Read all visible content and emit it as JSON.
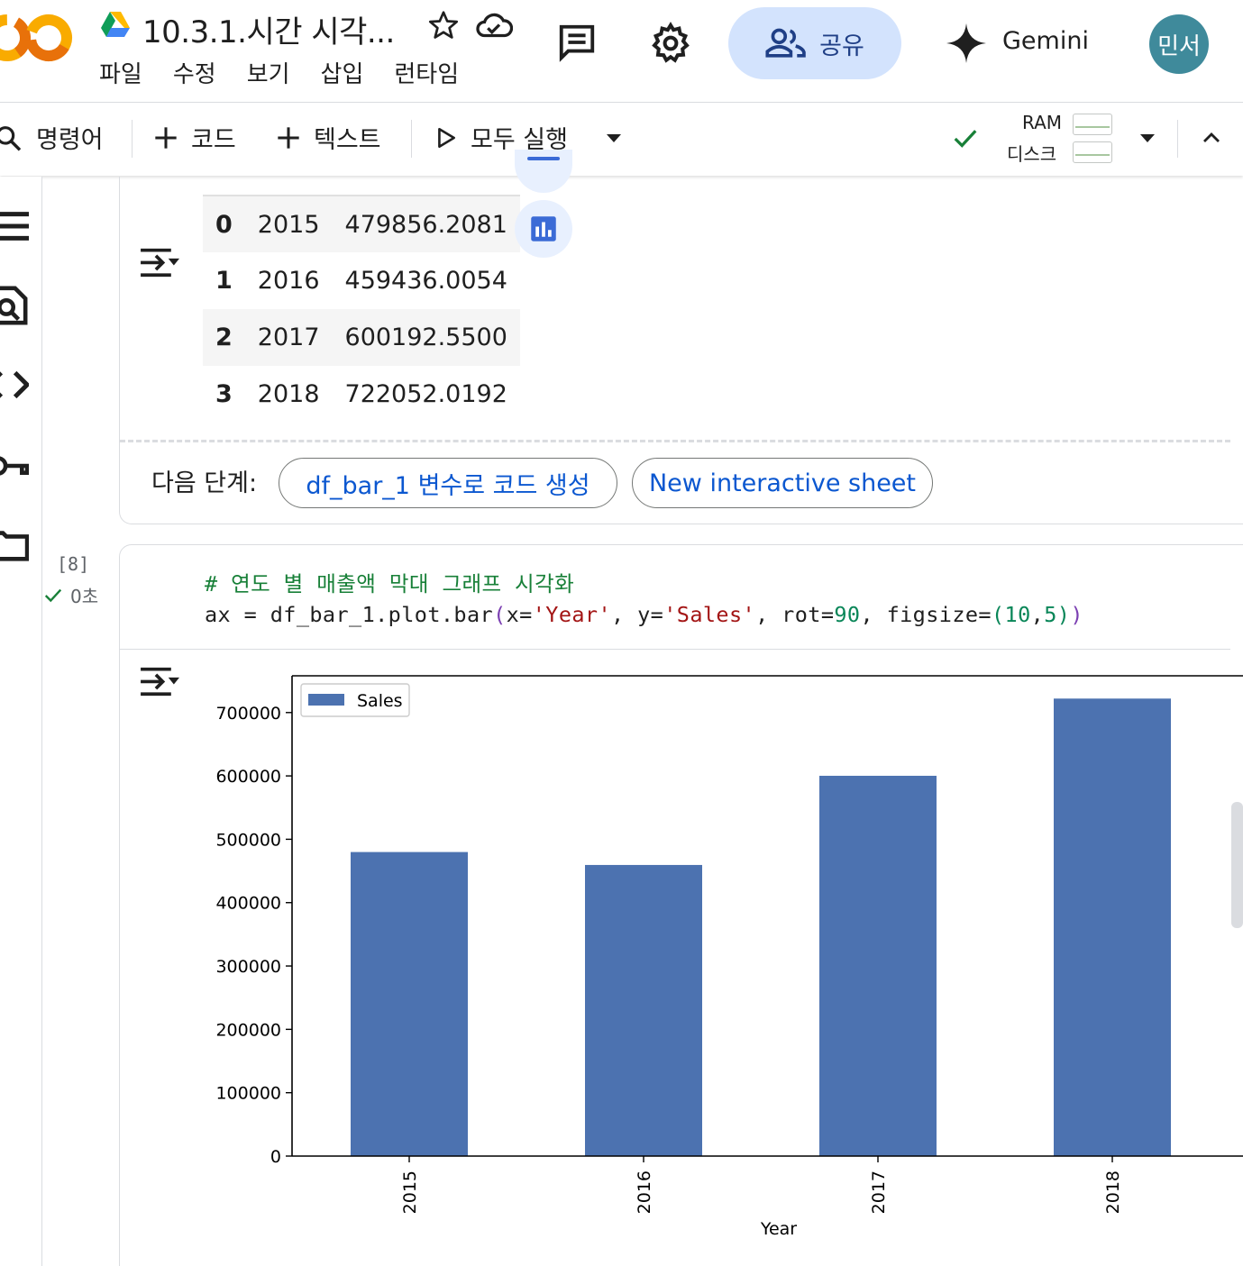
{
  "header": {
    "title": "10.3.1.시간 시각...",
    "menu": [
      "파일",
      "수정",
      "보기",
      "삽입",
      "런타임"
    ],
    "share_label": "공유",
    "gemini_label": "Gemini",
    "avatar_text": "민서"
  },
  "toolbar": {
    "command_label": "명령어",
    "add_code_label": "코드",
    "add_text_label": "텍스트",
    "run_all_label": "모두 실행",
    "ram_label": "RAM",
    "disk_label": "디스크"
  },
  "output_table": {
    "rows": [
      {
        "index": "0",
        "year": "2015",
        "sales": "479856.2081"
      },
      {
        "index": "1",
        "year": "2016",
        "sales": "459436.0054"
      },
      {
        "index": "2",
        "year": "2017",
        "sales": "600192.5500"
      },
      {
        "index": "3",
        "year": "2018",
        "sales": "722052.0192"
      }
    ]
  },
  "next_steps": {
    "label": "다음 단계:",
    "chip_1": "df_bar_1 변수로 코드 생성",
    "chip_2": "New interactive sheet"
  },
  "code_cell": {
    "execution_count": "[8]",
    "execution_time": "0초",
    "comment_line": "# 연도 별 매출액 막대 그래프 시각화",
    "code_parts": {
      "a": "ax = df_bar_1.plot.bar",
      "b": "(",
      "c": "x=",
      "d": "'Year'",
      "e": ", y=",
      "f": "'Sales'",
      "g": ", rot=",
      "h": "90",
      "i": ", figsize=",
      "j": "(",
      "k": "10",
      "l": ",",
      "m": "5",
      "n": ")",
      "o": ")"
    }
  },
  "chart_data": {
    "type": "bar",
    "categories": [
      "2015",
      "2016",
      "2017",
      "2018"
    ],
    "series": [
      {
        "name": "Sales",
        "values": [
          479856.2081,
          459436.0054,
          600192.55,
          722052.0192
        ],
        "color": "#4c72b0"
      }
    ],
    "xlabel": "Year",
    "ylabel": "",
    "ylim": [
      0,
      758000
    ],
    "yticks": [
      0,
      100000,
      200000,
      300000,
      400000,
      500000,
      600000,
      700000
    ],
    "ytick_labels": [
      "0",
      "100000",
      "200000",
      "300000",
      "400000",
      "500000",
      "600000",
      "700000"
    ],
    "legend": "top-left",
    "grid": false,
    "tick_rotation": 90
  },
  "colors": {
    "accent": "#0b57d0",
    "share_bg": "#d3e3fd",
    "bar": "#4c72b0",
    "avatar_bg": "#3f8a9b"
  }
}
